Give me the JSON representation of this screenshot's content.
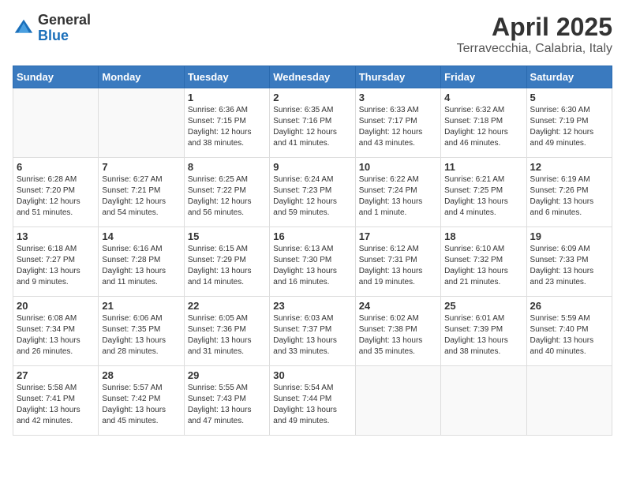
{
  "header": {
    "logo_general": "General",
    "logo_blue": "Blue",
    "month": "April 2025",
    "location": "Terravecchia, Calabria, Italy"
  },
  "calendar": {
    "days_of_week": [
      "Sunday",
      "Monday",
      "Tuesday",
      "Wednesday",
      "Thursday",
      "Friday",
      "Saturday"
    ],
    "weeks": [
      [
        {
          "day": "",
          "info": ""
        },
        {
          "day": "",
          "info": ""
        },
        {
          "day": "1",
          "info": "Sunrise: 6:36 AM\nSunset: 7:15 PM\nDaylight: 12 hours and 38 minutes."
        },
        {
          "day": "2",
          "info": "Sunrise: 6:35 AM\nSunset: 7:16 PM\nDaylight: 12 hours and 41 minutes."
        },
        {
          "day": "3",
          "info": "Sunrise: 6:33 AM\nSunset: 7:17 PM\nDaylight: 12 hours and 43 minutes."
        },
        {
          "day": "4",
          "info": "Sunrise: 6:32 AM\nSunset: 7:18 PM\nDaylight: 12 hours and 46 minutes."
        },
        {
          "day": "5",
          "info": "Sunrise: 6:30 AM\nSunset: 7:19 PM\nDaylight: 12 hours and 49 minutes."
        }
      ],
      [
        {
          "day": "6",
          "info": "Sunrise: 6:28 AM\nSunset: 7:20 PM\nDaylight: 12 hours and 51 minutes."
        },
        {
          "day": "7",
          "info": "Sunrise: 6:27 AM\nSunset: 7:21 PM\nDaylight: 12 hours and 54 minutes."
        },
        {
          "day": "8",
          "info": "Sunrise: 6:25 AM\nSunset: 7:22 PM\nDaylight: 12 hours and 56 minutes."
        },
        {
          "day": "9",
          "info": "Sunrise: 6:24 AM\nSunset: 7:23 PM\nDaylight: 12 hours and 59 minutes."
        },
        {
          "day": "10",
          "info": "Sunrise: 6:22 AM\nSunset: 7:24 PM\nDaylight: 13 hours and 1 minute."
        },
        {
          "day": "11",
          "info": "Sunrise: 6:21 AM\nSunset: 7:25 PM\nDaylight: 13 hours and 4 minutes."
        },
        {
          "day": "12",
          "info": "Sunrise: 6:19 AM\nSunset: 7:26 PM\nDaylight: 13 hours and 6 minutes."
        }
      ],
      [
        {
          "day": "13",
          "info": "Sunrise: 6:18 AM\nSunset: 7:27 PM\nDaylight: 13 hours and 9 minutes."
        },
        {
          "day": "14",
          "info": "Sunrise: 6:16 AM\nSunset: 7:28 PM\nDaylight: 13 hours and 11 minutes."
        },
        {
          "day": "15",
          "info": "Sunrise: 6:15 AM\nSunset: 7:29 PM\nDaylight: 13 hours and 14 minutes."
        },
        {
          "day": "16",
          "info": "Sunrise: 6:13 AM\nSunset: 7:30 PM\nDaylight: 13 hours and 16 minutes."
        },
        {
          "day": "17",
          "info": "Sunrise: 6:12 AM\nSunset: 7:31 PM\nDaylight: 13 hours and 19 minutes."
        },
        {
          "day": "18",
          "info": "Sunrise: 6:10 AM\nSunset: 7:32 PM\nDaylight: 13 hours and 21 minutes."
        },
        {
          "day": "19",
          "info": "Sunrise: 6:09 AM\nSunset: 7:33 PM\nDaylight: 13 hours and 23 minutes."
        }
      ],
      [
        {
          "day": "20",
          "info": "Sunrise: 6:08 AM\nSunset: 7:34 PM\nDaylight: 13 hours and 26 minutes."
        },
        {
          "day": "21",
          "info": "Sunrise: 6:06 AM\nSunset: 7:35 PM\nDaylight: 13 hours and 28 minutes."
        },
        {
          "day": "22",
          "info": "Sunrise: 6:05 AM\nSunset: 7:36 PM\nDaylight: 13 hours and 31 minutes."
        },
        {
          "day": "23",
          "info": "Sunrise: 6:03 AM\nSunset: 7:37 PM\nDaylight: 13 hours and 33 minutes."
        },
        {
          "day": "24",
          "info": "Sunrise: 6:02 AM\nSunset: 7:38 PM\nDaylight: 13 hours and 35 minutes."
        },
        {
          "day": "25",
          "info": "Sunrise: 6:01 AM\nSunset: 7:39 PM\nDaylight: 13 hours and 38 minutes."
        },
        {
          "day": "26",
          "info": "Sunrise: 5:59 AM\nSunset: 7:40 PM\nDaylight: 13 hours and 40 minutes."
        }
      ],
      [
        {
          "day": "27",
          "info": "Sunrise: 5:58 AM\nSunset: 7:41 PM\nDaylight: 13 hours and 42 minutes."
        },
        {
          "day": "28",
          "info": "Sunrise: 5:57 AM\nSunset: 7:42 PM\nDaylight: 13 hours and 45 minutes."
        },
        {
          "day": "29",
          "info": "Sunrise: 5:55 AM\nSunset: 7:43 PM\nDaylight: 13 hours and 47 minutes."
        },
        {
          "day": "30",
          "info": "Sunrise: 5:54 AM\nSunset: 7:44 PM\nDaylight: 13 hours and 49 minutes."
        },
        {
          "day": "",
          "info": ""
        },
        {
          "day": "",
          "info": ""
        },
        {
          "day": "",
          "info": ""
        }
      ]
    ]
  }
}
